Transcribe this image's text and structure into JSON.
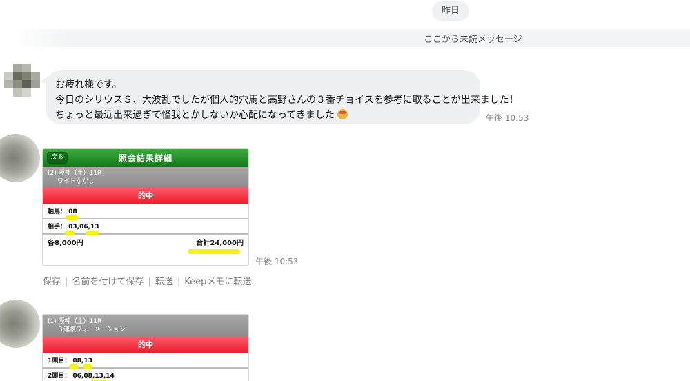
{
  "date_divider": "昨日",
  "unread_divider": "ここから未読メッセージ",
  "message1": {
    "lines": [
      "お疲れ様です。",
      "今日のシリウスＳ、大波乱でしたが個人的穴馬と高野さんの３番チョイスを参考に取ることが出来ました！",
      "ちょっと最近出来過ぎで怪我とかしないか心配になってきました"
    ],
    "emoji": "grinning-face-emoji",
    "time": "午後 10:53"
  },
  "card1": {
    "back_label": "戻る",
    "title": "照会結果詳細",
    "race": "(2) 阪神（土）11R",
    "bet_type": "ワイドながし",
    "hit_label": "的中",
    "rows": [
      {
        "label": "軸馬：",
        "value": "08"
      },
      {
        "label": "相手：",
        "value": "03,06,13"
      }
    ],
    "each_amount": "各8,000円",
    "total_amount": "合計24,000円",
    "time": "午後 10:53"
  },
  "actions": [
    "保存",
    "名前を付けて保存",
    "転送",
    "Keepメモに転送"
  ],
  "card2": {
    "race": "(1) 阪神（土）11R",
    "bet_type": "３連複フォーメーション",
    "hit_label": "的中",
    "rows": [
      {
        "label": "1頭目：",
        "value": "08,13"
      },
      {
        "label": "2頭目：",
        "value": "06,08,13,14"
      }
    ]
  },
  "colors": {
    "green": "#1e8f24",
    "red": "#ea1a2c",
    "highlight": "#f5f20f"
  }
}
